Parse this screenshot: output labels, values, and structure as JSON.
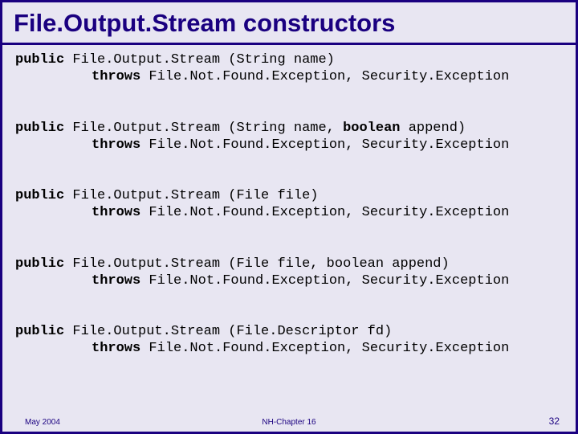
{
  "title": "File.Output.Stream constructors",
  "constructors": [
    {
      "kw1": "public",
      "sig1": " File.Output.Stream (String name)",
      "kw2": "throws",
      "sig2": " File.Not.Found.Exception, Security.Exception",
      "boolkw": null
    },
    {
      "kw1": "public",
      "sig1a": " File.Output.Stream (String name, ",
      "boolkw": "boolean",
      "sig1b": " append)",
      "kw2": "throws",
      "sig2": " File.Not.Found.Exception, Security.Exception"
    },
    {
      "kw1": "public",
      "sig1": " File.Output.Stream (File file)",
      "kw2": "throws",
      "sig2": " File.Not.Found.Exception, Security.Exception",
      "boolkw": null
    },
    {
      "kw1": "public",
      "sig1": " File.Output.Stream (File file, boolean append)",
      "kw2": "throws",
      "sig2": " File.Not.Found.Exception, Security.Exception",
      "boolkw": null
    },
    {
      "kw1": "public",
      "sig1": " File.Output.Stream (File.Descriptor fd)",
      "kw2": "throws",
      "sig2": " File.Not.Found.Exception, Security.Exception",
      "boolkw": null
    }
  ],
  "footer": {
    "left": "May 2004",
    "center": "NH-Chapter 16",
    "right": "32"
  }
}
